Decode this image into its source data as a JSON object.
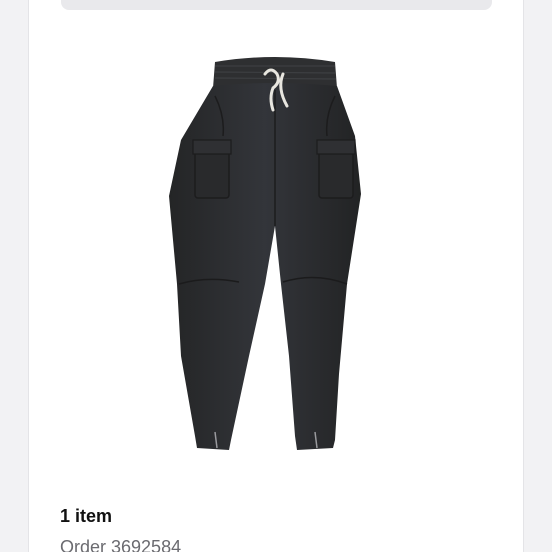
{
  "summary": {
    "item_count": "1 item",
    "order_number": "Order 3692584"
  },
  "product": {
    "image_icon": "cargo-pants-image"
  },
  "colors": {
    "page_background": "#f2f2f4",
    "card_background": "#ffffff",
    "garment": "#2b2c2d",
    "drawstring": "#e8e6df"
  }
}
